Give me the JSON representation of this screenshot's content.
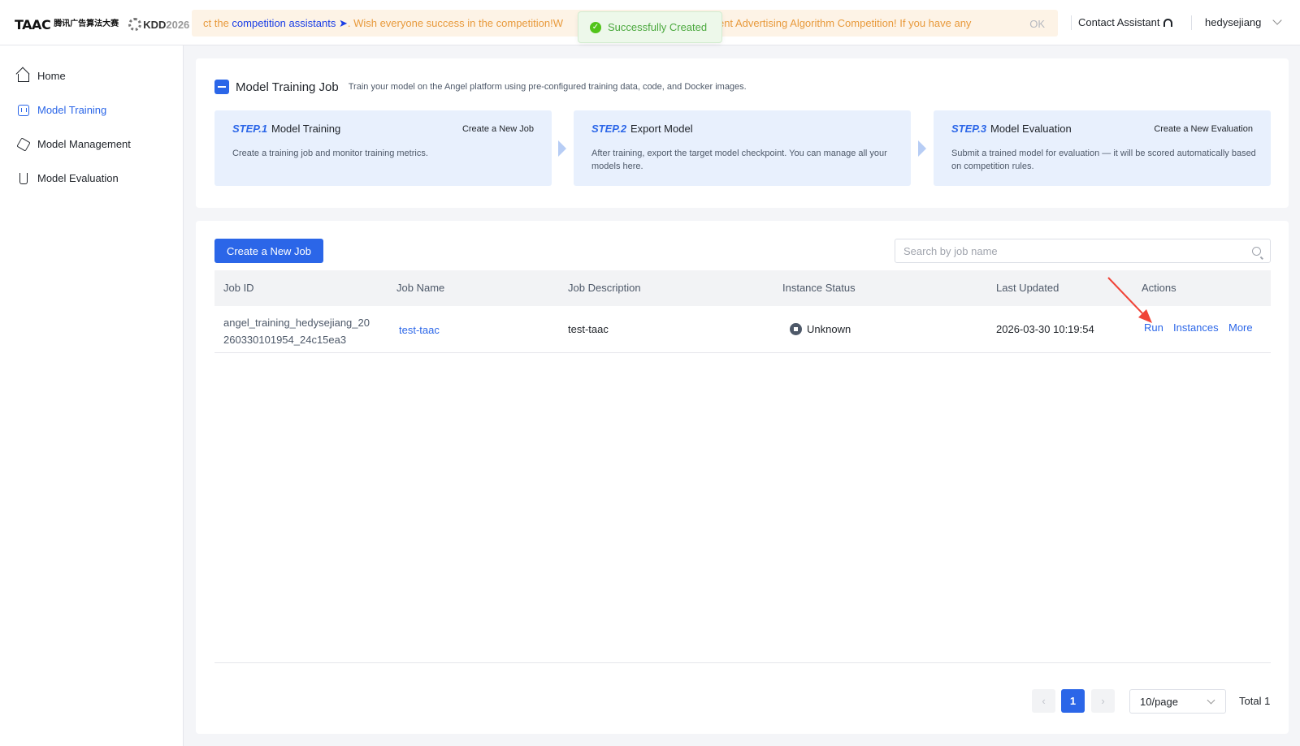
{
  "header": {
    "logo_text": "TAAC",
    "logo_cn": "腾讯广告算法大赛",
    "logo_kdd": "KDD",
    "logo_kdd_year": "2026",
    "banner": {
      "text_before": "ct the ",
      "link_text": "competition assistants",
      "arrow": " ➤",
      "text_after": ". Wish everyone success in the competition!W",
      "text_tail": "encent Advertising Algorithm Competition! If you have any",
      "ok_label": "OK"
    },
    "toast": "Successfully Created",
    "contact_label": "Contact Assistant",
    "username": "hedysejiang"
  },
  "sidebar": {
    "items": [
      {
        "label": "Home",
        "icon": "home-icon"
      },
      {
        "label": "Model Training",
        "icon": "training-icon",
        "active": true
      },
      {
        "label": "Model Management",
        "icon": "cube-icon"
      },
      {
        "label": "Model Evaluation",
        "icon": "flask-icon"
      }
    ]
  },
  "intro": {
    "title": "Model Training Job",
    "subtitle": "Train your model on the Angel platform using pre-configured training data, code, and Docker images.",
    "steps": [
      {
        "num": "STEP.1",
        "name": "Model Training",
        "action": "Create a New Job",
        "desc": "Create a training job and monitor training metrics."
      },
      {
        "num": "STEP.2",
        "name": "Export Model",
        "action": "",
        "desc": "After training, export the target model checkpoint. You can manage all your models here."
      },
      {
        "num": "STEP.3",
        "name": "Model Evaluation",
        "action": "Create a New Evaluation",
        "desc": "Submit a trained model for evaluation — it will be scored automatically based on competition rules."
      }
    ]
  },
  "toolbar": {
    "create_label": "Create a New Job",
    "search_placeholder": "Search by job name"
  },
  "table": {
    "headers": [
      "Job ID",
      "Job Name",
      "Job Description",
      "Instance Status",
      "Last Updated",
      "Actions"
    ],
    "rows": [
      {
        "job_id_line1": "angel_training_hedysejiang_20",
        "job_id_line2": "260330101954_24c15ea3",
        "job_name": "test-taac",
        "description": "test-taac",
        "status": "Unknown",
        "last_updated": "2026-03-30 10:19:54",
        "actions": [
          "Run",
          "Instances",
          "More"
        ]
      }
    ]
  },
  "pagination": {
    "current": "1",
    "page_size": "10/page",
    "total": "Total 1"
  },
  "colors": {
    "accent": "#2b66e8",
    "banner_bg": "#fdf3e6",
    "banner_text": "#e89a3c",
    "toast_text": "#4aa83d",
    "annotation_arrow": "#f04438"
  }
}
